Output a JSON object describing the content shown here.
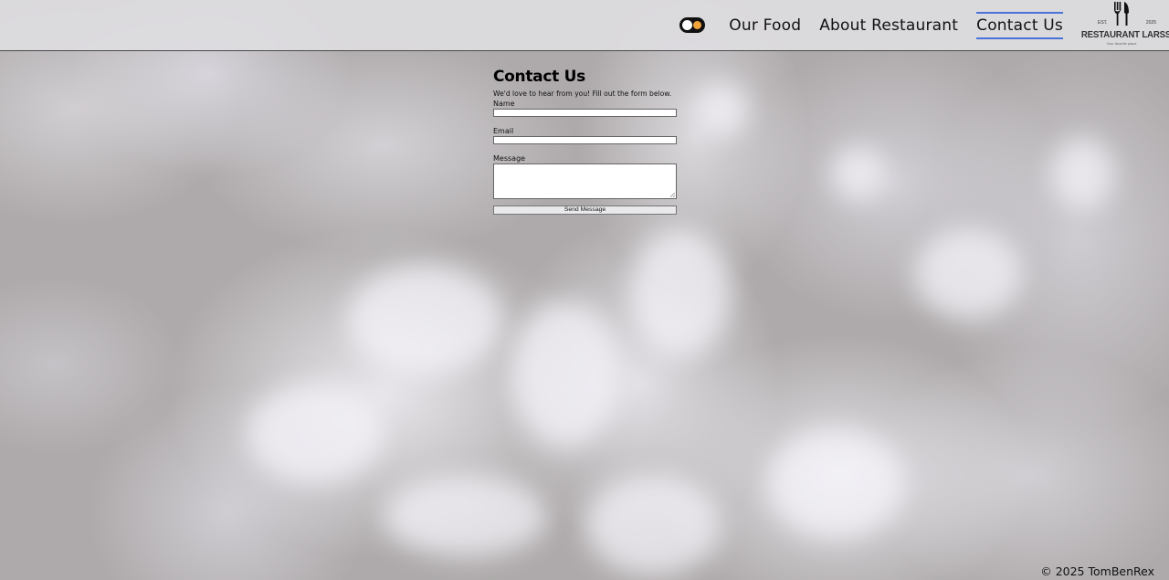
{
  "nav": {
    "items": [
      {
        "label": "Our Food",
        "active": false
      },
      {
        "label": "About Restaurant",
        "active": false
      },
      {
        "label": "Contact Us",
        "active": true
      }
    ],
    "theme_toggle_icon": "sun-moon-toggle-icon"
  },
  "logo": {
    "est": "EST.",
    "year": "2025",
    "name": "RESTAURANT LARSSON",
    "tagline": "Your favorite place",
    "icon": "fork-knife-icon"
  },
  "contact": {
    "title": "Contact Us",
    "intro": "We'd love to hear from you! Fill out the form below.",
    "name_label": "Name",
    "name_value": "",
    "email_label": "Email",
    "email_value": "",
    "message_label": "Message",
    "message_value": "",
    "send_label": "Send Message"
  },
  "footer": {
    "text": "© 2025 TomBenRex"
  },
  "colors": {
    "accent": "#4a72d8",
    "header_bg": "#dedde0",
    "toggle_sun": "#f2a33a"
  }
}
